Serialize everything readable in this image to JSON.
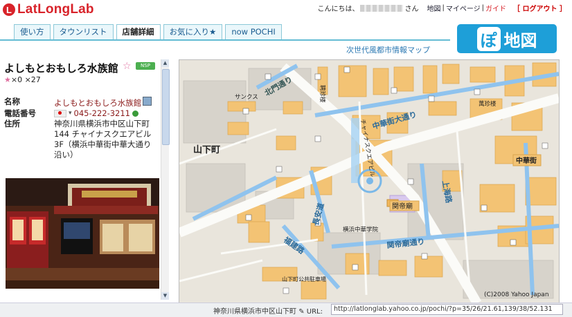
{
  "header": {
    "logo_text": "LatLongLab",
    "greeting_prefix": "こんにちは、",
    "greeting_suffix": "さん",
    "nav": [
      "地図",
      "マイページ",
      "ガイド"
    ],
    "logout": "［ ログアウト ］"
  },
  "tabs": [
    {
      "label": "使い方",
      "active": false
    },
    {
      "label": "タウンリスト",
      "active": false
    },
    {
      "label": "店舗詳細",
      "active": true
    },
    {
      "label": "お気に入り★",
      "active": false
    },
    {
      "label": "now POCHI",
      "active": false
    }
  ],
  "brand": {
    "po": "ぽ",
    "chizu": "地図",
    "subtitle": "次世代風都市情報マップ"
  },
  "shop": {
    "title": "よしもとおもしろ水族館",
    "ratings": "×0 ×27",
    "name_label": "名称",
    "name_value": "よしもとおもしろ水族館",
    "phone_label": "電話番号",
    "phone_value": "045-222-3211",
    "address_label": "住所",
    "address_value": "神奈川県横浜市中区山下町144 チャイナスクエアビル3F（横浜中華街中華大通り沿い）"
  },
  "map": {
    "labels": {
      "kitamon": "北門通り",
      "chinatown_st": "中華街大通り",
      "yamashita": "山下町",
      "chukagai": "中華街",
      "kanteibyo1": "関帝廟",
      "kanteibyo2": "関帝廟",
      "kanteibyo_st": "関帝廟通り",
      "fukken": "福建路",
      "choan": "長安道",
      "shanghai": "上海路",
      "square": "チャイナスクエアビル",
      "sankus": "サンクス",
      "yamashita_garage": "山下町公共駐車場",
      "yokohama_school": "横浜中華学院",
      "heichin": "聘珍楼",
      "hofukuen": "萬珍楼",
      "copyright": "(C)2008 Yahoo Japan"
    }
  },
  "statusbar": {
    "address": "神奈川県横浜市中区山下町",
    "url_label": "URL:",
    "url": "http://latlonglab.yahoo.co.jp/pochi/?p=35/26/21.61,139/38/52.131"
  },
  "colors": {
    "accent": "#d8232a",
    "tab_border": "#8cc8d8",
    "pochi_blue": "#1e9fd8",
    "map_bg": "#eae6dd",
    "road_blue": "#8fc3ee",
    "building_orange": "#f3c374"
  }
}
